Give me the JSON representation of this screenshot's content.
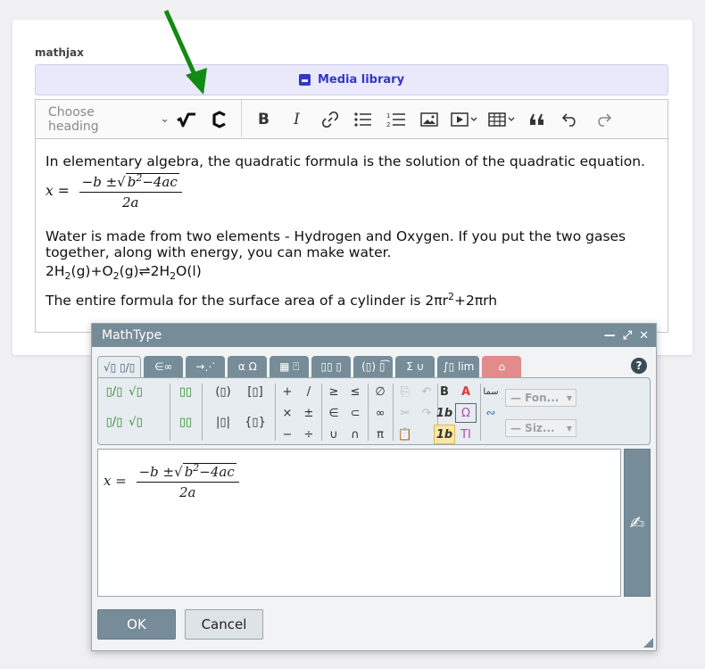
{
  "field_label": "mathjax",
  "media_library": {
    "label": "Media library"
  },
  "toolbar": {
    "heading_placeholder": "Choose heading",
    "heading_chevron": "⌄",
    "items": [
      {
        "name": "mathtype-icon",
        "glyph": "√"
      },
      {
        "name": "chemtype-icon",
        "glyph": "C"
      },
      {
        "name": "bold-icon",
        "glyph": "B"
      },
      {
        "name": "italic-icon",
        "glyph": "I"
      },
      {
        "name": "link-icon",
        "glyph": "🔗"
      },
      {
        "name": "bulleted-list-icon",
        "glyph": "☰"
      },
      {
        "name": "numbered-list-icon",
        "glyph": "≡"
      },
      {
        "name": "image-icon",
        "glyph": "▧"
      },
      {
        "name": "media-embed-icon",
        "glyph": "▶"
      },
      {
        "name": "table-icon",
        "glyph": "▦"
      },
      {
        "name": "blockquote-icon",
        "glyph": "❝"
      },
      {
        "name": "undo-icon",
        "glyph": "↶"
      },
      {
        "name": "redo-icon",
        "glyph": "↷"
      }
    ]
  },
  "content": {
    "p1": "In elementary algebra, the quadratic formula is the solution of the quadratic equation.",
    "formula": {
      "lhs": "x",
      "eq": "=",
      "num_pre": "−b ±",
      "sqrt_b": "b",
      "sqrt_exp": "2",
      "sqrt_rest": "−4ac",
      "den": "2a"
    },
    "p2": "Water is made from two elements - Hydrogen and Oxygen. If you put the two gases together, along with energy, you can make water.",
    "chem": {
      "a": "2H",
      "a_sub": "2",
      "a_state": "(g)",
      "plus": "+",
      "b": "O",
      "b_sub": "2",
      "b_state": "(g)",
      "arrow": "⇌",
      "c": "2H",
      "c_sub": "2",
      "c_rest": "O(l)"
    },
    "p3_text": "The entire formula for the surface area of a cylinder is ",
    "p3_math_a": "2πr",
    "p3_exp": "2",
    "p3_math_b": "+2πrh"
  },
  "dialog": {
    "title": "MathType",
    "controls": [
      "—",
      "⤢",
      "✕"
    ],
    "tabs": [
      "√▯ ▯/▯",
      "∈∞",
      "→⋰",
      "α Ω",
      "▦ ⍞",
      "▯▯ ▯",
      "(▯) ▯͡",
      "Σ ∪",
      "∫▯ lim",
      "⌂"
    ],
    "help": "?",
    "palette": {
      "g1": [
        "▯/▯",
        "▯/▯",
        "√▯",
        "√▯"
      ],
      "g2": [
        "▯▯",
        "▯▯"
      ],
      "g3": [
        "(▯)",
        "|▯|",
        "[▯]",
        "{▯}"
      ],
      "g4": [
        "+",
        "×",
        "−",
        "/",
        "±",
        "÷"
      ],
      "g5": [
        "≥",
        "∈",
        "∪",
        "≤",
        "⊂",
        "∩"
      ],
      "g6": [
        "∅",
        "∞",
        "π"
      ],
      "g7": [
        "⎘",
        "✂",
        "📋",
        "↶",
        "↷"
      ],
      "g8": [
        "B",
        "1b",
        "1b",
        "A",
        "Ω",
        "TI"
      ],
      "g9": [
        "سما",
        "∾"
      ],
      "font_combo": "— Fon...",
      "size_combo": "— Siz..."
    },
    "editor_formula": {
      "lhs": "x",
      "eq": "=",
      "num_pre": "−b ±",
      "sqrt_b": "b",
      "sqrt_exp": "2",
      "sqrt_rest": "−4ac",
      "den": "2a"
    },
    "handwriting_icon": "✍",
    "ok": "OK",
    "cancel": "Cancel"
  },
  "colors": {
    "accent": "#3535c8",
    "dialog_header": "#778c99",
    "arrow": "#138a13"
  }
}
